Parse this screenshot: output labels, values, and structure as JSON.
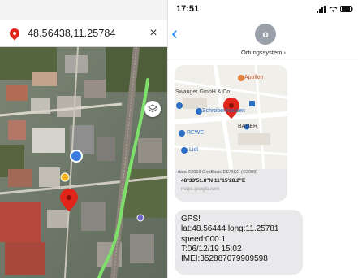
{
  "map_app": {
    "coordinates": "48.56438,11.25784",
    "close_label": "×",
    "pin_icon": "map-pin-icon",
    "layers_icon": "layers-icon",
    "colors": {
      "pin": "#e0251b",
      "route": "#7ee06a",
      "location_dot": "#3b7ce0"
    }
  },
  "messages": {
    "status_time": "17:51",
    "back_label": "‹",
    "contact": {
      "initial": "o",
      "name": "Ortungssystem ›"
    },
    "location_card": {
      "places": [
        "Apollon",
        "Swanger GmbH & Co",
        "Schrobenhausen",
        "BAUER",
        "REWE",
        "Lidl"
      ],
      "copyright": "data ©2019 GeoBasis-DE/BKG (©2009)",
      "dms": "48°33'51.8\"N 11°15'28.2\"E",
      "url": "maps.google.com"
    },
    "sms_lines": [
      "GPS!",
      "lat:48.56444 long:11.25781",
      "speed:000.1",
      "T:06/12/19 15:02",
      "IMEI:352887079909598"
    ],
    "colors": {
      "bubble": "#e9e9eb",
      "accent": "#1a7cf5"
    }
  }
}
